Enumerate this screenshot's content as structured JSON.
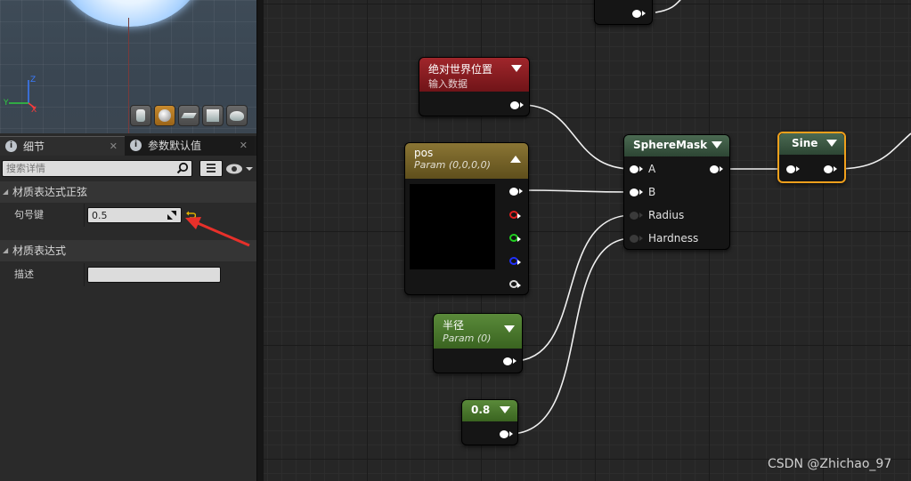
{
  "left_panel": {
    "viewport": {
      "axis_labels": {
        "z": "Z",
        "y": "Y",
        "x": "X"
      },
      "preview_buttons": [
        {
          "icon": "cylinder-icon",
          "active": false
        },
        {
          "icon": "sphere-icon",
          "active": true
        },
        {
          "icon": "plane-icon",
          "active": false
        },
        {
          "icon": "cube-icon",
          "active": false
        },
        {
          "icon": "teapot-icon",
          "active": false
        }
      ]
    },
    "tabs": [
      {
        "label": "细节",
        "icon": "info-icon"
      },
      {
        "label": "参数默认值",
        "icon": "info-icon"
      }
    ],
    "search": {
      "placeholder": "搜索详情"
    },
    "categories": [
      {
        "label": "材质表达式正弦",
        "properties": [
          {
            "label": "句号键",
            "value": "0.5"
          }
        ]
      },
      {
        "label": "材质表达式",
        "properties": [
          {
            "label": "描述",
            "value": ""
          }
        ]
      }
    ]
  },
  "graph": {
    "nodes": {
      "world_position": {
        "title": "绝对世界位置",
        "subtitle": "输入数据"
      },
      "pos": {
        "title": "pos",
        "subtitle": "Param (0,0,0,0)"
      },
      "radius": {
        "title": "半径",
        "subtitle": "Param (0)"
      },
      "constant": {
        "title": "0.8"
      },
      "spheremask": {
        "title": "SphereMask",
        "inputs": [
          "A",
          "B",
          "Radius",
          "Hardness"
        ]
      },
      "sine": {
        "title": "Sine"
      }
    },
    "colors": {
      "world_position_header": "#9b1f24",
      "pos_header": "#7d6a2a",
      "scalar_header": "#4b7a2c",
      "function_header": "#3f5a44",
      "selection": "#f0a01c",
      "annotation_arrow": "#e8302a"
    }
  },
  "watermark": "CSDN @Zhichao_97"
}
